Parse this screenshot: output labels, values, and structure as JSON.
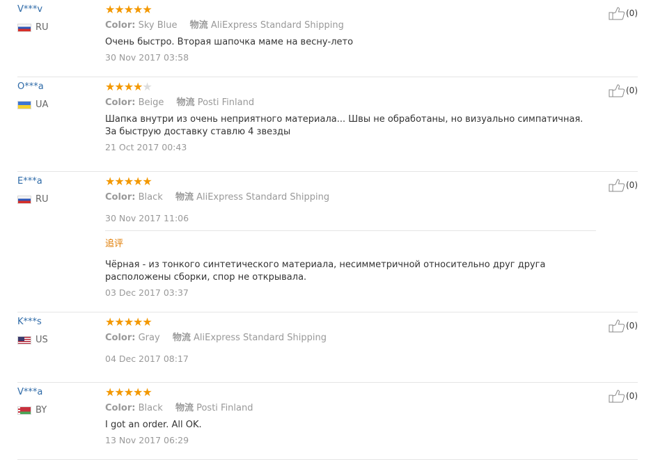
{
  "reviews": [
    {
      "user": "V***v",
      "country": "RU",
      "flag": "ru",
      "rating": 5,
      "color_label": "Color:",
      "color_value": "Sky Blue",
      "shipping_label": "物流",
      "shipping_value": "AliExpress Standard Shipping",
      "text": "Очень быстро. Вторая шапочка маме на весну-лето",
      "date": "30 Nov 2017 03:58",
      "useful": "(0)"
    },
    {
      "user": "O***a",
      "country": "UA",
      "flag": "ua",
      "rating": 4,
      "color_label": "Color:",
      "color_value": "Beige",
      "shipping_label": "物流",
      "shipping_value": "Posti Finland",
      "text": "Шапка внутри из очень неприятного материала... Швы не обработаны, но визуально симпатичная. За быструю доставку ставлю 4 звезды",
      "date": "21 Oct 2017 00:43",
      "useful": "(0)"
    },
    {
      "user": "E***a",
      "country": "RU",
      "flag": "ru",
      "rating": 5,
      "color_label": "Color:",
      "color_value": "Black",
      "shipping_label": "物流",
      "shipping_value": "AliExpress Standard Shipping",
      "text": "",
      "date": "30 Nov 2017 11:06",
      "useful": "(0)",
      "additional": {
        "label": "追评",
        "text": "Чёрная - из тонкого синтетического материала, несимметричной относительно друг друга расположены сборки, спор не открывала.",
        "date": "03 Dec 2017 03:37"
      }
    },
    {
      "user": "K***s",
      "country": "US",
      "flag": "us",
      "rating": 5,
      "color_label": "Color:",
      "color_value": "Gray",
      "shipping_label": "物流",
      "shipping_value": "AliExpress Standard Shipping",
      "text": "",
      "date": "04 Dec 2017 08:17",
      "useful": "(0)"
    },
    {
      "user": "V***a",
      "country": "BY",
      "flag": "by",
      "rating": 5,
      "color_label": "Color:",
      "color_value": "Black",
      "shipping_label": "物流",
      "shipping_value": "Posti Finland",
      "text": "I got an order. All OK.",
      "date": "13 Nov 2017 06:29",
      "useful": "(0)"
    }
  ],
  "icons": {
    "star": "star-icon",
    "thumb": "thumbs-up-icon"
  },
  "colors": {
    "star": "#f39800",
    "username": "#2f6ba8",
    "followup": "#e07b00"
  }
}
